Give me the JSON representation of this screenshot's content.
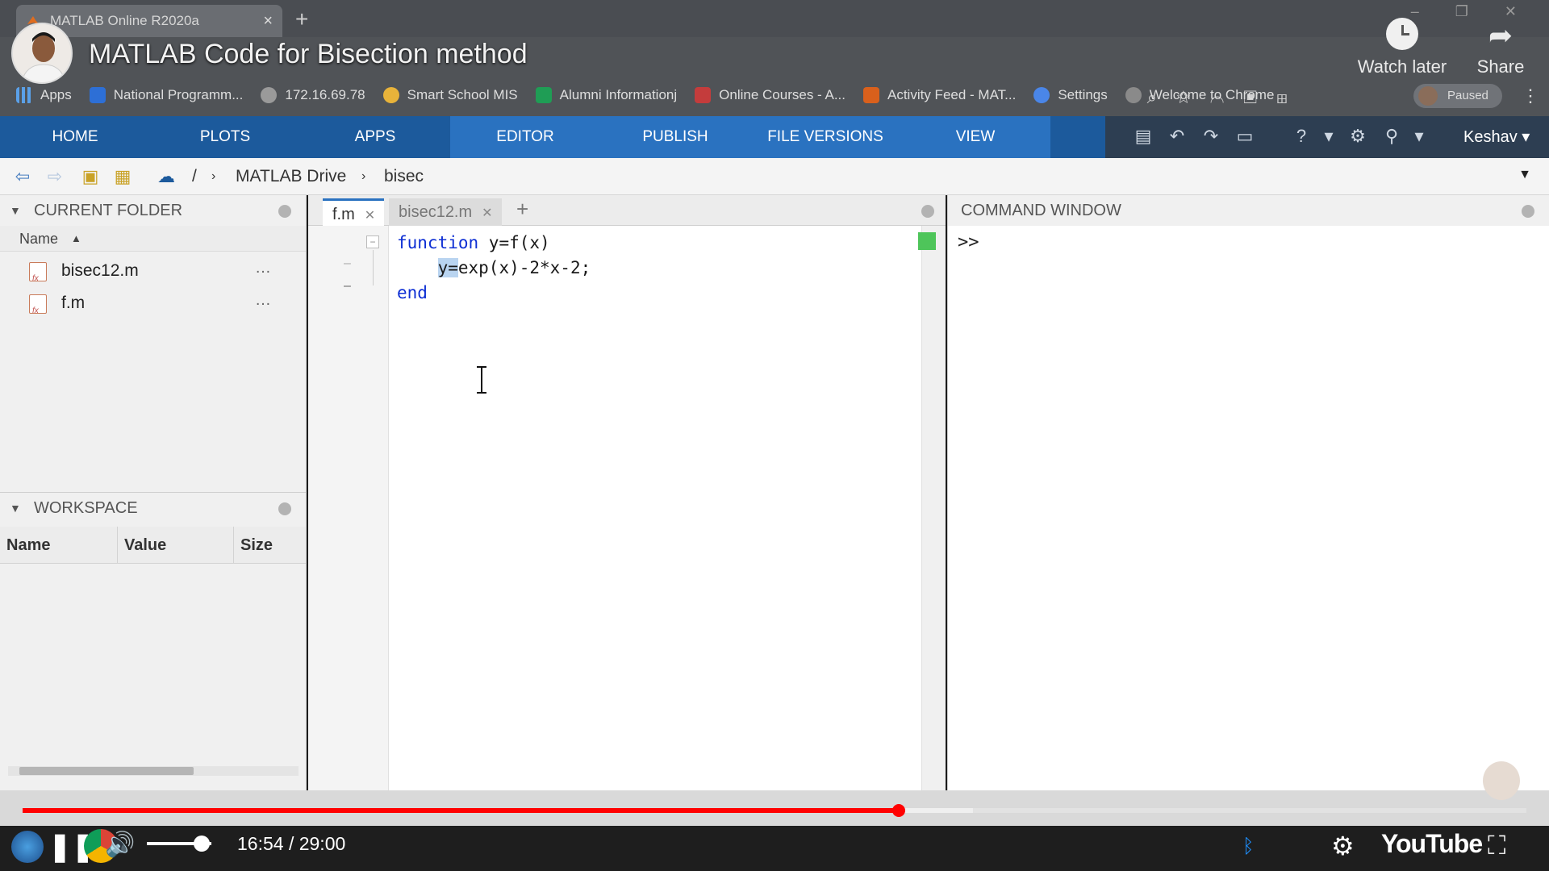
{
  "browser": {
    "tab_title": "MATLAB Online R2020a",
    "bookmarks": [
      "Apps",
      "National Programm...",
      "172.16.69.78",
      "Smart School MIS",
      "Alumni Informationj",
      "Online Courses - A...",
      "Activity Feed - MAT...",
      "Settings",
      "Welcome to Chrome"
    ],
    "paused_label": "Paused"
  },
  "video": {
    "title": "MATLAB Code for Bisection method",
    "watch_later": "Watch later",
    "share": "Share",
    "time": "16:54 / 29:00",
    "progress": 0.5828,
    "buffered": 0.632,
    "volume": 0.85,
    "logo": "YouTube"
  },
  "matlab": {
    "ribbon_tabs": [
      "HOME",
      "PLOTS",
      "APPS",
      "EDITOR",
      "PUBLISH",
      "FILE VERSIONS",
      "VIEW"
    ],
    "active_tab": "EDITOR",
    "user": "Keshav",
    "breadcrumb": [
      "/",
      "MATLAB Drive",
      "bisec"
    ],
    "current_folder": {
      "title": "CURRENT FOLDER",
      "column": "Name",
      "files": [
        "bisec12.m",
        "f.m"
      ]
    },
    "workspace": {
      "title": "WORKSPACE",
      "columns": [
        "Name",
        "Value",
        "Size"
      ]
    },
    "editor": {
      "tabs": [
        "f.m",
        "bisec12.m"
      ],
      "code": {
        "line1_kw": "function",
        "line1_rest": " y=f(x)",
        "line2_sel": "y=",
        "line2_rest": "exp(x)-2*x-2;",
        "line3_kw": "end"
      }
    },
    "command_window": {
      "title": "COMMAND WINDOW",
      "prompt": ">>"
    }
  },
  "colors": {
    "ribbon": "#1c5a9c",
    "ribbon_active": "#2a72c0",
    "keyword": "#0e2fd4",
    "progress": "#ff0000"
  }
}
